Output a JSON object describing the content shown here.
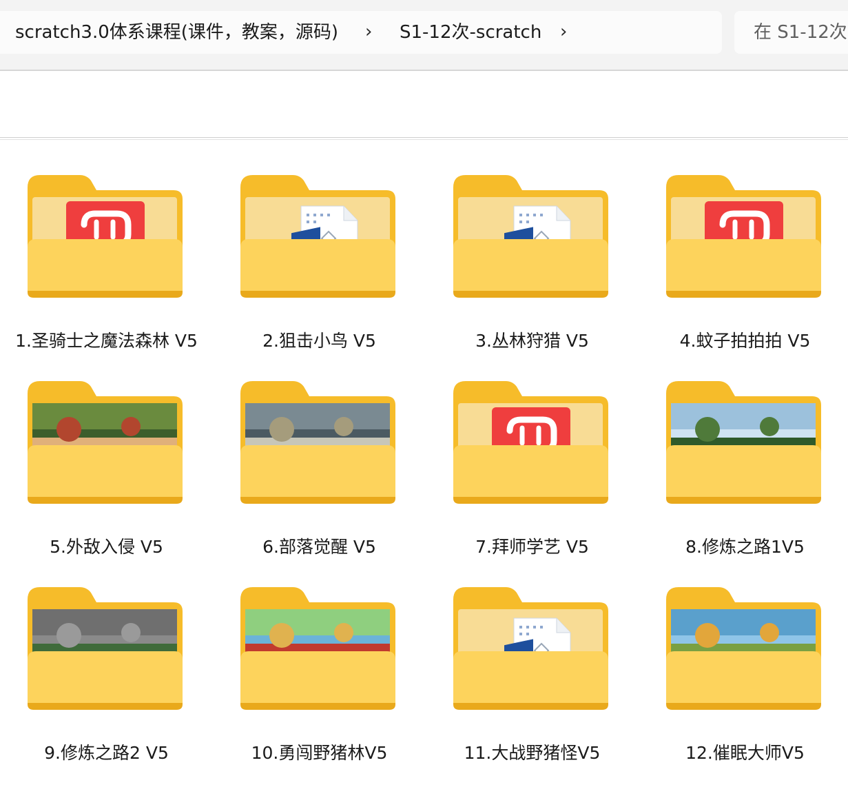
{
  "breadcrumb": {
    "items": [
      "scratch3.0体系课程(课件，教案，源码)",
      "S1-12次-scratch"
    ],
    "separator": "›"
  },
  "search": {
    "placeholder": "在 S1-12次"
  },
  "folders": [
    {
      "name": "1.圣骑士之魔法森林 V5",
      "thumb": "app-icon"
    },
    {
      "name": "2.狙击小鸟 V5",
      "thumb": "document-icon"
    },
    {
      "name": "3.丛林狩猎 V5",
      "thumb": "document-icon"
    },
    {
      "name": "4.蚊子拍拍拍 V5",
      "thumb": "app-icon"
    },
    {
      "name": "5.外敌入侵 V5",
      "thumb": "image-preview"
    },
    {
      "name": "6.部落觉醒 V5",
      "thumb": "image-preview"
    },
    {
      "name": "7.拜师学艺 V5",
      "thumb": "app-icon"
    },
    {
      "name": "8.修炼之路1V5",
      "thumb": "image-preview"
    },
    {
      "name": "9.修炼之路2 V5",
      "thumb": "image-preview"
    },
    {
      "name": "10.勇闯野猪林V5",
      "thumb": "image-preview"
    },
    {
      "name": "11.大战野猪怪V5",
      "thumb": "document-icon"
    },
    {
      "name": "12.催眠大师V5",
      "thumb": "image-preview"
    }
  ],
  "colors": {
    "folder_back": "#f6bc2a",
    "folder_front": "#fdd35c",
    "app_red": "#ef3e3e",
    "doc_blue": "#1e4f9d"
  }
}
